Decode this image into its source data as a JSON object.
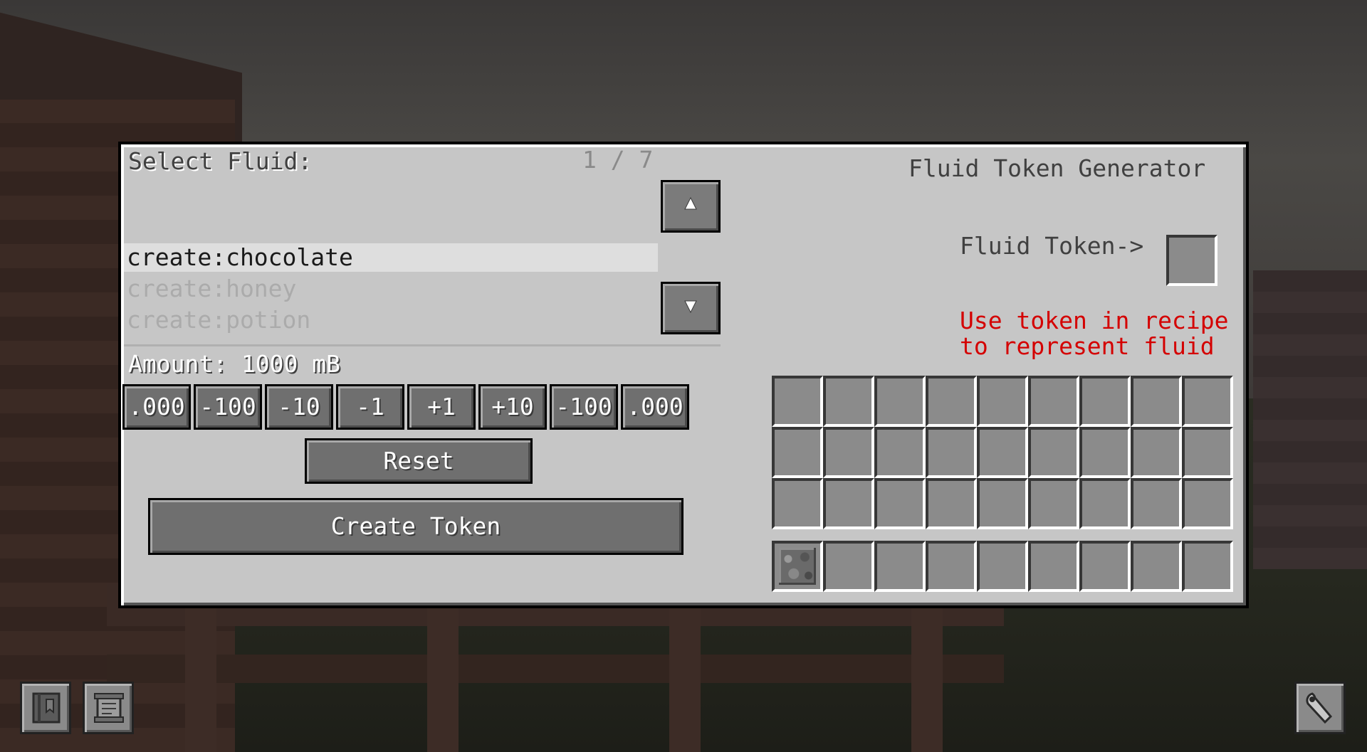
{
  "gui": {
    "select_label": "Select Fluid:",
    "page_indicator": "1 / 7",
    "title": "Fluid Token Generator",
    "token_label": "Fluid Token->",
    "hint_line1": "Use token in recipe",
    "hint_line2": "to represent fluid",
    "hint_color": "#d40000"
  },
  "fluids": [
    {
      "name": "create:chocolate",
      "selected": true
    },
    {
      "name": "create:honey",
      "selected": false
    },
    {
      "name": "create:potion",
      "selected": false
    }
  ],
  "scroll": {
    "up_icon": "arrow-up-icon",
    "down_icon": "arrow-down-icon"
  },
  "amount": {
    "label": "Amount: 1000 mB",
    "buttons": [
      ".000",
      "-100",
      "-10",
      "-1",
      "+1",
      "+10",
      "-100",
      ".000"
    ]
  },
  "actions": {
    "reset": "Reset",
    "create": "Create Token"
  },
  "inventory": {
    "main_slots": 27,
    "hotbar_slots": 9,
    "hotbar_first_item": "cobblestone-icon"
  },
  "corner_buttons": [
    "book-icon",
    "scroll-icon",
    "wrench-icon"
  ]
}
